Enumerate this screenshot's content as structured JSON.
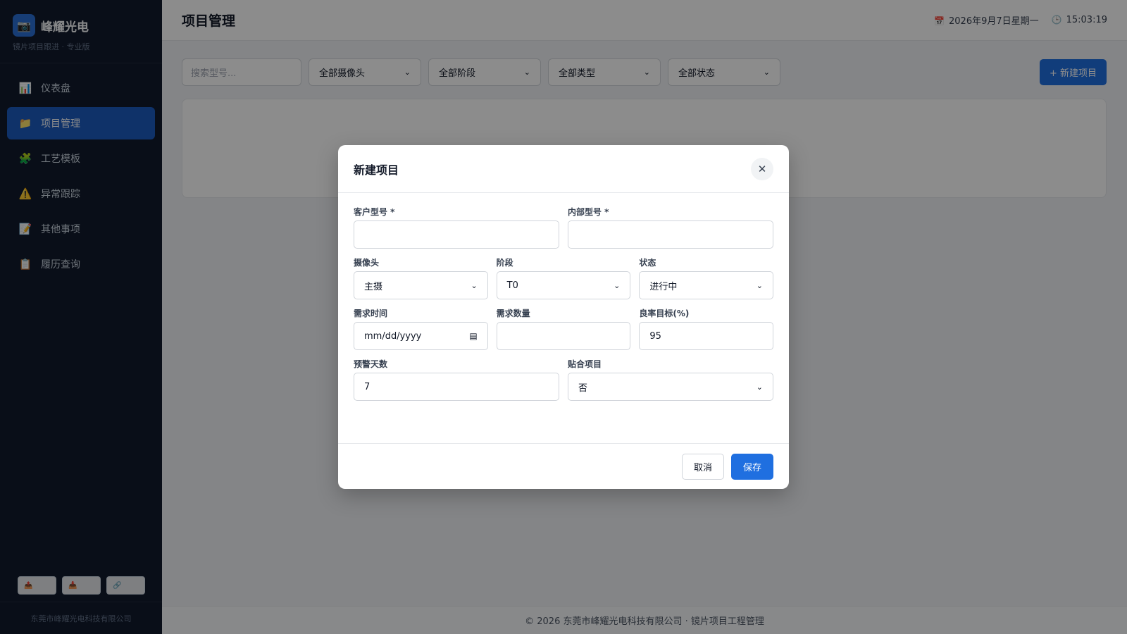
{
  "sidebar": {
    "brand_name": "峰耀光电",
    "brand_sub": "镜片项目跟进 · 专业版",
    "items": [
      {
        "label": "仪表盘",
        "icon": "📊"
      },
      {
        "label": "项目管理",
        "icon": "📁"
      },
      {
        "label": "工艺模板",
        "icon": "🧩"
      },
      {
        "label": "异常跟踪",
        "icon": "⚠️"
      },
      {
        "label": "其他事项",
        "icon": "📝"
      },
      {
        "label": "履历查询",
        "icon": "📋"
      }
    ],
    "tools": [
      "📤",
      "📥",
      "🔗"
    ],
    "footer": "东莞市峰耀光电科技有限公司"
  },
  "topbar": {
    "title": "项目管理",
    "date": "2026年9月7日星期一",
    "time": "15:03:19"
  },
  "filters": {
    "search_placeholder": "搜索型号...",
    "camera": "全部摄像头",
    "stage": "全部阶段",
    "type": "全部类型",
    "status": "全部状态",
    "new_button": "+ 新建项目"
  },
  "footer": "© 2026 东莞市峰耀光电科技有限公司 · 镜片项目工程管理",
  "modal": {
    "title": "新建项目",
    "customer_model_label": "客户型号 *",
    "customer_model_value": "",
    "internal_model_label": "内部型号 *",
    "internal_model_value": "",
    "camera_label": "摄像头",
    "camera_value": "主摄",
    "stage_label": "阶段",
    "stage_value": "T0",
    "status_label": "状态",
    "status_value": "进行中",
    "demand_time_label": "需求时间",
    "demand_time_value": "mm/dd/yyyy",
    "demand_qty_label": "需求数量",
    "demand_qty_value": "",
    "yield_target_label": "良率目标(%)",
    "yield_target_value": "95",
    "warning_days_label": "预警天数",
    "warning_days_value": "7",
    "bonding_label": "贴合项目",
    "bonding_value": "否",
    "cancel_label": "取消",
    "save_label": "保存"
  }
}
